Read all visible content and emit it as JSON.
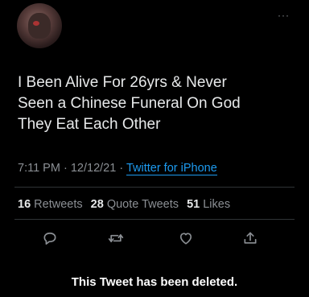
{
  "tweet": {
    "text_lines": [
      "I Been Alive For 26yrs & Never",
      "Seen a Chinese Funeral On God",
      "They Eat Each Other"
    ],
    "time": "7:11 PM",
    "date": "12/12/21",
    "separator": "·",
    "source": "Twitter for iPhone"
  },
  "stats": {
    "retweets_count": "16",
    "retweets_label": "Retweets",
    "quotes_count": "28",
    "quotes_label": "Quote Tweets",
    "likes_count": "51",
    "likes_label": "Likes"
  },
  "more_label": "···",
  "actions": {
    "icons": [
      "reply-icon",
      "retweet-icon",
      "like-icon",
      "share-icon"
    ]
  },
  "footer": {
    "deleted_notice": "This Tweet has been deleted."
  },
  "colors": {
    "background": "#000000",
    "text": "#e7e9ea",
    "secondary": "#8b8f94",
    "link": "#1d9bf0",
    "divider": "#2f3336"
  }
}
